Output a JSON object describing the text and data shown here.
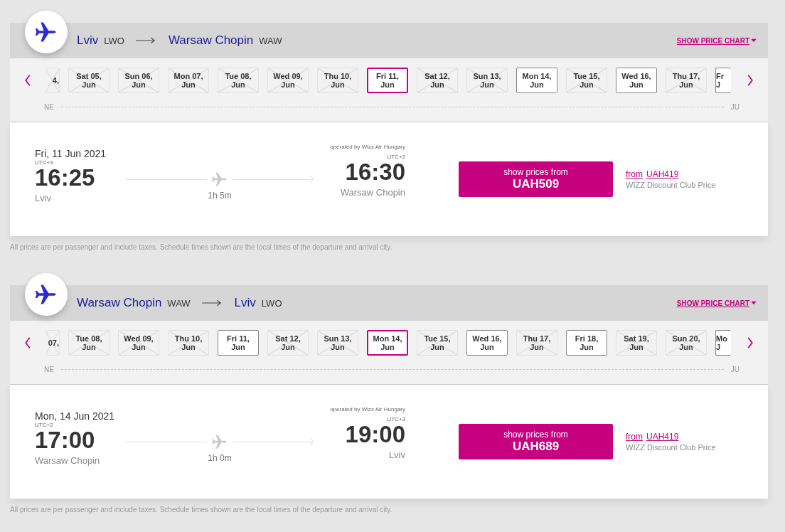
{
  "flights": [
    {
      "origin": {
        "city": "Lviv",
        "code": "LWO"
      },
      "destination": {
        "city": "Warsaw Chopin",
        "code": "WAW"
      },
      "price_chart_link": "SHOW PRICE CHART",
      "dates": [
        {
          "kind": "cut-start",
          "day": "4,",
          "available": false,
          "selected": false
        },
        {
          "kind": "full",
          "day": "Sat 05,",
          "month": "Jun",
          "available": false,
          "selected": false
        },
        {
          "kind": "full",
          "day": "Sun 06,",
          "month": "Jun",
          "available": false,
          "selected": false
        },
        {
          "kind": "full",
          "day": "Mon 07,",
          "month": "Jun",
          "available": false,
          "selected": false
        },
        {
          "kind": "full",
          "day": "Tue 08,",
          "month": "Jun",
          "available": false,
          "selected": false
        },
        {
          "kind": "full",
          "day": "Wed 09,",
          "month": "Jun",
          "available": false,
          "selected": false
        },
        {
          "kind": "full",
          "day": "Thu 10,",
          "month": "Jun",
          "available": false,
          "selected": false
        },
        {
          "kind": "full",
          "day": "Fri 11,",
          "month": "Jun",
          "available": true,
          "selected": true
        },
        {
          "kind": "full",
          "day": "Sat 12,",
          "month": "Jun",
          "available": false,
          "selected": false
        },
        {
          "kind": "full",
          "day": "Sun 13,",
          "month": "Jun",
          "available": false,
          "selected": false
        },
        {
          "kind": "full",
          "day": "Mon 14,",
          "month": "Jun",
          "available": true,
          "selected": false
        },
        {
          "kind": "full",
          "day": "Tue 15,",
          "month": "Jun",
          "available": false,
          "selected": false
        },
        {
          "kind": "full",
          "day": "Wed 16,",
          "month": "Jun",
          "available": true,
          "selected": false
        },
        {
          "kind": "full",
          "day": "Thu 17,",
          "month": "Jun",
          "available": false,
          "selected": false
        },
        {
          "kind": "cut-end",
          "day": "Fr",
          "month": "J",
          "available": true,
          "selected": false
        }
      ],
      "month_start": "NE",
      "month_end": "JU",
      "date": "Fri, 11 Jun 2021",
      "operator": "operated by Wizz Air Hungary",
      "departure": {
        "utc": "UTC+3",
        "time": "16:25",
        "city": "Lviv"
      },
      "duration": "1h 5m",
      "arrival": {
        "utc": "UTC+2",
        "time": "16:30",
        "city": "Warsaw Chopin"
      },
      "price_button": {
        "label": "show prices from",
        "price": "UAH509"
      },
      "club": {
        "from": "from",
        "price": "UAH419",
        "label": "WIZZ Discount Club Price"
      },
      "note": "All prices are per passenger and include taxes. Schedule times shown are the local times of the departure and arrival city."
    },
    {
      "origin": {
        "city": "Warsaw Chopin",
        "code": "WAW"
      },
      "destination": {
        "city": "Lviv",
        "code": "LWO"
      },
      "price_chart_link": "SHOW PRICE CHART",
      "dates": [
        {
          "kind": "cut-start",
          "day": "07,",
          "available": false,
          "selected": false
        },
        {
          "kind": "full",
          "day": "Tue 08,",
          "month": "Jun",
          "available": false,
          "selected": false
        },
        {
          "kind": "full",
          "day": "Wed 09,",
          "month": "Jun",
          "available": false,
          "selected": false
        },
        {
          "kind": "full",
          "day": "Thu 10,",
          "month": "Jun",
          "available": false,
          "selected": false
        },
        {
          "kind": "full",
          "day": "Fri 11,",
          "month": "Jun",
          "available": true,
          "selected": false
        },
        {
          "kind": "full",
          "day": "Sat 12,",
          "month": "Jun",
          "available": false,
          "selected": false
        },
        {
          "kind": "full",
          "day": "Sun 13,",
          "month": "Jun",
          "available": false,
          "selected": false
        },
        {
          "kind": "full",
          "day": "Mon 14,",
          "month": "Jun",
          "available": true,
          "selected": true
        },
        {
          "kind": "full",
          "day": "Tue 15,",
          "month": "Jun",
          "available": false,
          "selected": false
        },
        {
          "kind": "full",
          "day": "Wed 16,",
          "month": "Jun",
          "available": true,
          "selected": false
        },
        {
          "kind": "full",
          "day": "Thu 17,",
          "month": "Jun",
          "available": false,
          "selected": false
        },
        {
          "kind": "full",
          "day": "Fri 18,",
          "month": "Jun",
          "available": true,
          "selected": false
        },
        {
          "kind": "full",
          "day": "Sat 19,",
          "month": "Jun",
          "available": false,
          "selected": false
        },
        {
          "kind": "full",
          "day": "Sun 20,",
          "month": "Jun",
          "available": false,
          "selected": false
        },
        {
          "kind": "cut-end",
          "day": "Mo",
          "month": "J",
          "available": true,
          "selected": false
        }
      ],
      "month_start": "NE",
      "month_end": "JU",
      "date": "Mon, 14 Jun 2021",
      "operator": "operated by Wizz Air Hungary",
      "departure": {
        "utc": "UTC+2",
        "time": "17:00",
        "city": "Warsaw Chopin"
      },
      "duration": "1h 0m",
      "arrival": {
        "utc": "UTC+3",
        "time": "19:00",
        "city": "Lviv"
      },
      "price_button": {
        "label": "show prices from",
        "price": "UAH689"
      },
      "club": {
        "from": "from",
        "price": "UAH419",
        "label": "WIZZ Discount Club Price"
      },
      "note": "All prices are per passenger and include taxes. Schedule times shown are the local times of the departure and arrival city."
    }
  ]
}
